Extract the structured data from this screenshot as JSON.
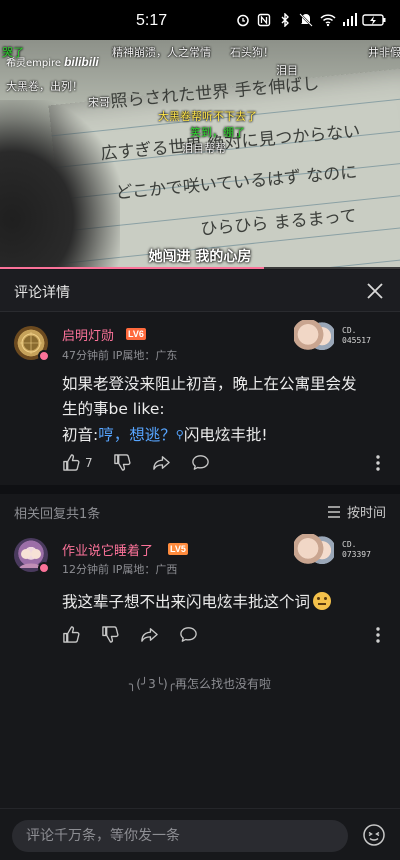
{
  "status_bar": {
    "time": "5:17",
    "icons": [
      "alarm-icon",
      "nfc-icon",
      "bluetooth-icon",
      "mute-icon",
      "wifi-icon",
      "signal-5g-icon",
      "battery-icon"
    ]
  },
  "video": {
    "logo_text": "希灵empire",
    "logo_brand": "bilibili",
    "subtitle": "她闯进 我的心房",
    "progress_percent": 66,
    "handwriting": [
      "照らされた世界 手を伸ばし",
      "広すぎる世界 絶対に見つからない",
      "どこかで咲いているはず なのに",
      "ひらひら まるまって"
    ],
    "danmaku": [
      {
        "text": "哭了",
        "color": "green"
      },
      {
        "text": "精神崩溃，人之常情",
        "color": "white"
      },
      {
        "text": "石头狗！",
        "color": "white"
      },
      {
        "text": "井非假",
        "color": "white"
      },
      {
        "text": "大黑卷，出列！",
        "color": "white"
      },
      {
        "text": "宋哥",
        "color": "white"
      },
      {
        "text": "大黑卷帮听不下去了",
        "color": "yellow"
      },
      {
        "text": "笑到，绷了",
        "color": "green"
      },
      {
        "text": "泪目帮帮",
        "color": "white"
      },
      {
        "text": "泪目",
        "color": "white"
      }
    ]
  },
  "panel": {
    "title": "评论详情"
  },
  "main_comment": {
    "username": "启明灯勋",
    "level": "LV6",
    "time_location": "47分钟前 IP属地：广东",
    "fan_no_label": "CD.",
    "fan_no": "045517",
    "text_line1": "如果老登没来阻止初音，晚上在公寓里会发",
    "text_line2": "生的事be like:",
    "text_line3_pre": "初音:",
    "text_line3_link": "哼，想逃？",
    "text_line3_post": "闪电炫丰批!",
    "likes": "7"
  },
  "replies": {
    "count_label": "相关回复共1条",
    "sort_label": "按时间"
  },
  "reply_comment": {
    "username": "作业说它睡着了",
    "level": "LV5",
    "time_location": "12分钟前 IP属地：广西",
    "fan_no_label": "CD.",
    "fan_no": "073397",
    "text": "我这辈子想不出来闪电炫丰批这个词"
  },
  "end_text": "╮(╯3╰)╭再怎么找也没有啦",
  "input": {
    "placeholder": "评论千万条，等你发一条"
  },
  "colors": {
    "accent_pink": "#fb7299",
    "link_blue": "#57a5ff",
    "background": "#17181b"
  }
}
